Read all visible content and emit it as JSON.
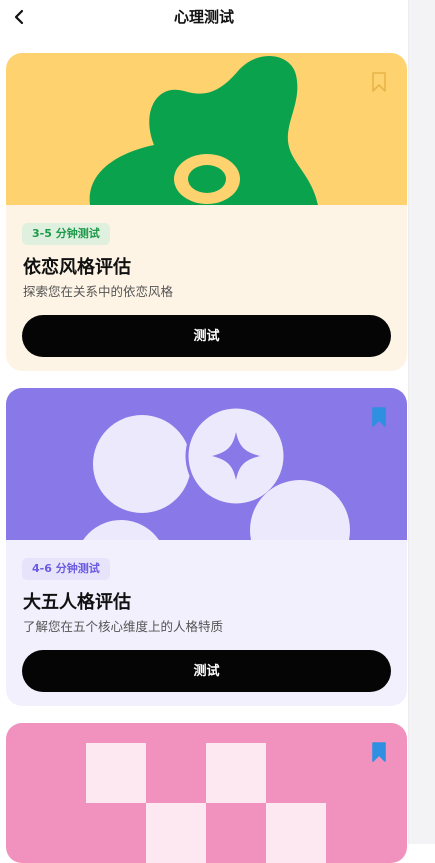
{
  "header": {
    "title": "心理测试",
    "back_icon": "chevron-left-icon"
  },
  "cards": [
    {
      "badge": "3-5 分钟测试",
      "title": "依恋风格评估",
      "subtitle": "探索您在关系中的依恋风格",
      "button": "测试",
      "bookmarked": false,
      "colors": {
        "hero": "#fdd26f",
        "body": "#fdf4e6",
        "art": "#0aa24d",
        "badge_bg": "#dff0df",
        "badge_text": "#1d9a4a"
      }
    },
    {
      "badge": "4-6 分钟测试",
      "title": "大五人格评估",
      "subtitle": "了解您在五个核心维度上的人格特质",
      "button": "测试",
      "bookmarked": true,
      "colors": {
        "hero": "#8878e8",
        "body": "#f2f0fd",
        "art": "#ebe9fb",
        "badge_bg": "#e7e3fb",
        "badge_text": "#6a5be0",
        "bookmark": "#2f8fe0"
      }
    },
    {
      "bookmarked": true,
      "colors": {
        "hero": "#f192be",
        "art": "#fde7f0",
        "bookmark": "#2f8fe0"
      }
    }
  ]
}
